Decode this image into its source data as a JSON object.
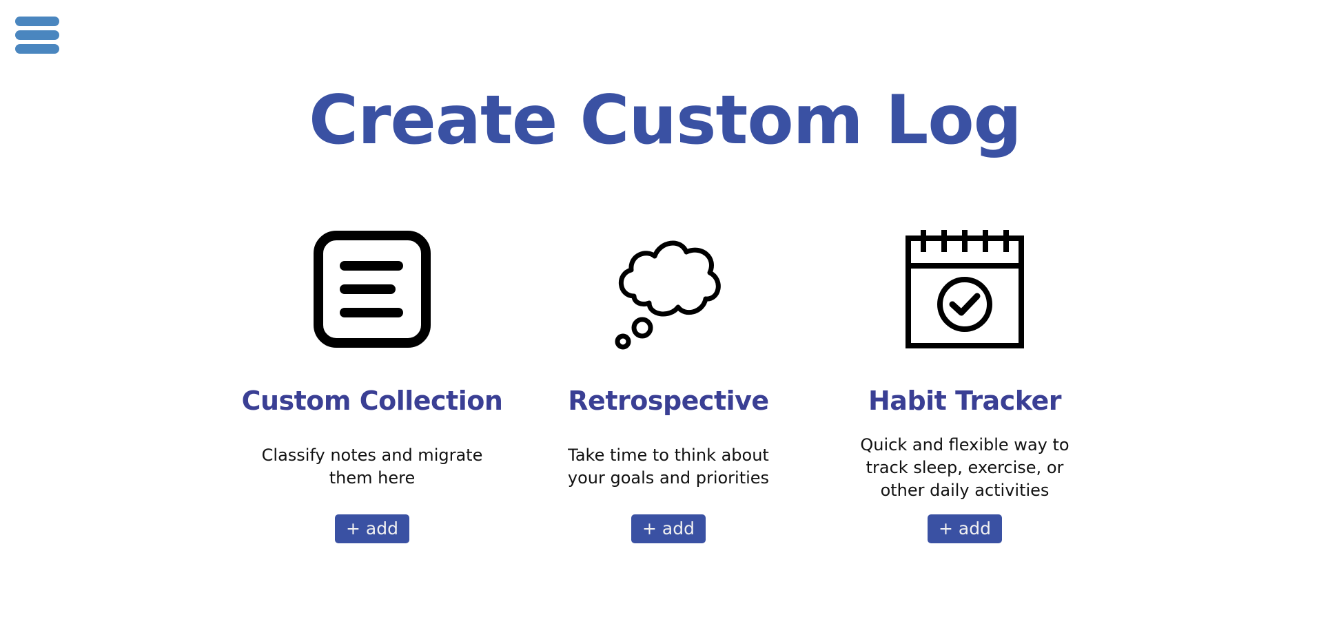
{
  "nav": {
    "menu_icon": "hamburger-menu-icon",
    "menu_color": "#4a86bf"
  },
  "header": {
    "title": "Create Custom Log",
    "title_color": "#3a51a3"
  },
  "cards": [
    {
      "icon": "notes-list-icon",
      "title": "Custom Collection",
      "description": "Classify notes and migrate them here",
      "button_label": "+ add"
    },
    {
      "icon": "thought-cloud-icon",
      "title": "Retrospective",
      "description": "Take time to think about your goals and priorities",
      "button_label": "+ add"
    },
    {
      "icon": "calendar-check-icon",
      "title": "Habit Tracker",
      "description": "Quick and flexible way to track sleep, exercise, or other daily activities",
      "button_label": "+ add"
    }
  ],
  "colors": {
    "accent": "#3a51a3",
    "card_title": "#3a3f94",
    "button_text": "#f1f1f1"
  }
}
